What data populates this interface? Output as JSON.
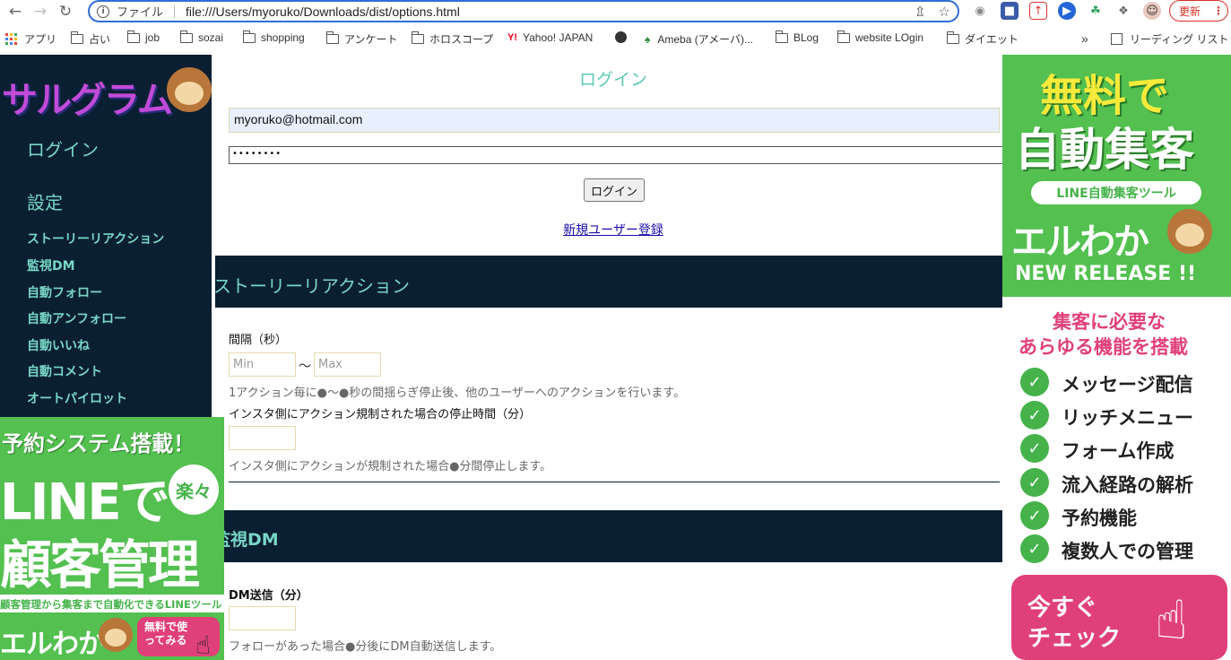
{
  "browser": {
    "scheme_label": "ファイル",
    "url": "file:///Users/myoruko/Downloads/dist/options.html",
    "update_label": "更新"
  },
  "bookmarks": [
    {
      "label": "アプリ",
      "icon": "apps-grid-icon"
    },
    {
      "label": "占い",
      "icon": "folder-icon"
    },
    {
      "label": "job",
      "icon": "folder-icon"
    },
    {
      "label": "sozai",
      "icon": "folder-icon"
    },
    {
      "label": "shopping",
      "icon": "folder-icon"
    },
    {
      "label": "アンケート",
      "icon": "folder-icon"
    },
    {
      "label": "ホロスコープ",
      "icon": "folder-icon"
    },
    {
      "label": "Yahoo! JAPAN",
      "icon": "yahoo-icon"
    },
    {
      "label": "",
      "icon": "globe-icon"
    },
    {
      "label": "Ameba (アメーバ)...",
      "icon": "ameba-icon"
    },
    {
      "label": "BLog",
      "icon": "folder-icon"
    },
    {
      "label": "website LOgin",
      "icon": "folder-icon"
    },
    {
      "label": "ダイエット",
      "icon": "folder-icon"
    }
  ],
  "bookmarks_more": "»",
  "reading_list": "リーディング リスト",
  "sidebar": {
    "logo": "サルグラム",
    "heading_login": "ログイン",
    "heading_settings": "設定",
    "items": [
      "ストーリーリアクション",
      "監視DM",
      "自動フォロー",
      "自動アンフォロー",
      "自動いいね",
      "自動コメント",
      "オートパイロット"
    ]
  },
  "login": {
    "title": "ログイン",
    "email": "myoruko@hotmail.com",
    "password_mask": "••••••••",
    "button": "ログイン",
    "register_link": "新規ユーザー登録"
  },
  "story_reaction": {
    "title": "ストーリーリアクション",
    "interval_label": "間隔（秒）",
    "min_placeholder": "Min",
    "max_placeholder": "Max",
    "tilde": "〜",
    "interval_help": "1アクション毎に●〜●秒の間揺らぎ停止後、他のユーザーへのアクションを行います。",
    "stop_label": "インスタ側にアクション規制された場合の停止時間（分）",
    "stop_help": "インスタ側にアクションが規制された場合●分間停止します。"
  },
  "monitor_dm": {
    "title": "監視DM",
    "send_label": "DM送信（分）",
    "send_help": "フォローがあった場合●分後にDM自動送信します。"
  },
  "ad_left": {
    "line1": "予約システム搭載！",
    "line2": "LINEで",
    "badge": "楽々",
    "line3": "顧客管理",
    "line4": "顧客管理から集客まで自動化できるLINEツール",
    "brand": "エルわか",
    "cta": "無料で使ってみる"
  },
  "ad_right": {
    "line1": "無料で",
    "line2": "自動集客",
    "pill": "LINE自動集客ツール",
    "brand": "エルわか",
    "release": "NEW RELEASE !!",
    "sub1": "集客に必要な",
    "sub2": "あらゆる機能を搭載",
    "features": [
      "メッセージ配信",
      "リッチメニュー",
      "フォーム作成",
      "流入経路の解析",
      "予約機能",
      "複数人での管理"
    ],
    "cta1": "今すぐ",
    "cta2": "チェック"
  },
  "colors": {
    "navy": "#0b1f32",
    "teal": "#78d6c6",
    "ad_green": "#53c050",
    "cta_pink": "#e0407a"
  }
}
